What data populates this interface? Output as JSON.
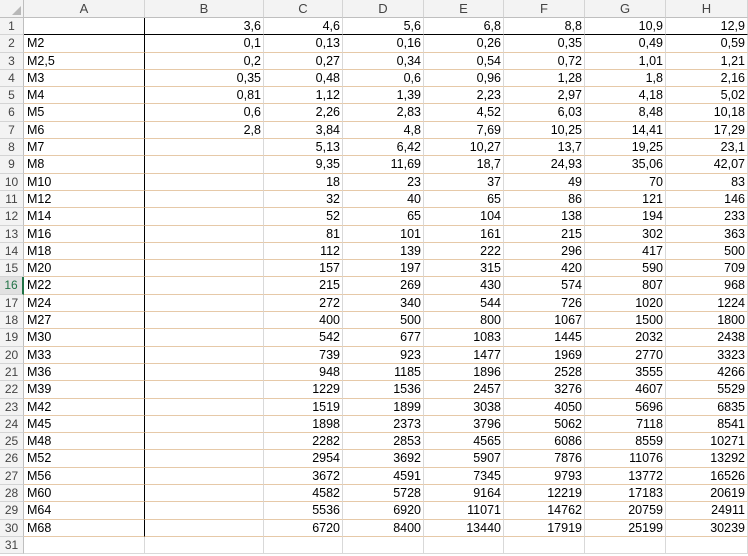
{
  "columns": [
    "A",
    "B",
    "C",
    "D",
    "E",
    "F",
    "G",
    "H"
  ],
  "rows": [
    [
      "",
      "3,6",
      "4,6",
      "5,6",
      "6,8",
      "8,8",
      "10,9",
      "12,9"
    ],
    [
      "M2",
      "0,1",
      "0,13",
      "0,16",
      "0,26",
      "0,35",
      "0,49",
      "0,59"
    ],
    [
      "M2,5",
      "0,2",
      "0,27",
      "0,34",
      "0,54",
      "0,72",
      "1,01",
      "1,21"
    ],
    [
      "M3",
      "0,35",
      "0,48",
      "0,6",
      "0,96",
      "1,28",
      "1,8",
      "2,16"
    ],
    [
      "M4",
      "0,81",
      "1,12",
      "1,39",
      "2,23",
      "2,97",
      "4,18",
      "5,02"
    ],
    [
      "M5",
      "0,6",
      "2,26",
      "2,83",
      "4,52",
      "6,03",
      "8,48",
      "10,18"
    ],
    [
      "M6",
      "2,8",
      "3,84",
      "4,8",
      "7,69",
      "10,25",
      "14,41",
      "17,29"
    ],
    [
      "M7",
      "",
      "5,13",
      "6,42",
      "10,27",
      "13,7",
      "19,25",
      "23,1"
    ],
    [
      "M8",
      "",
      "9,35",
      "11,69",
      "18,7",
      "24,93",
      "35,06",
      "42,07"
    ],
    [
      "M10",
      "",
      "18",
      "23",
      "37",
      "49",
      "70",
      "83"
    ],
    [
      "M12",
      "",
      "32",
      "40",
      "65",
      "86",
      "121",
      "146"
    ],
    [
      "M14",
      "",
      "52",
      "65",
      "104",
      "138",
      "194",
      "233"
    ],
    [
      "M16",
      "",
      "81",
      "101",
      "161",
      "215",
      "302",
      "363"
    ],
    [
      "M18",
      "",
      "112",
      "139",
      "222",
      "296",
      "417",
      "500"
    ],
    [
      "M20",
      "",
      "157",
      "197",
      "315",
      "420",
      "590",
      "709"
    ],
    [
      "M22",
      "",
      "215",
      "269",
      "430",
      "574",
      "807",
      "968"
    ],
    [
      "M24",
      "",
      "272",
      "340",
      "544",
      "726",
      "1020",
      "1224"
    ],
    [
      "M27",
      "",
      "400",
      "500",
      "800",
      "1067",
      "1500",
      "1800"
    ],
    [
      "M30",
      "",
      "542",
      "677",
      "1083",
      "1445",
      "2032",
      "2438"
    ],
    [
      "M33",
      "",
      "739",
      "923",
      "1477",
      "1969",
      "2770",
      "3323"
    ],
    [
      "M36",
      "",
      "948",
      "1185",
      "1896",
      "2528",
      "3555",
      "4266"
    ],
    [
      "M39",
      "",
      "1229",
      "1536",
      "2457",
      "3276",
      "4607",
      "5529"
    ],
    [
      "M42",
      "",
      "1519",
      "1899",
      "3038",
      "4050",
      "5696",
      "6835"
    ],
    [
      "M45",
      "",
      "1898",
      "2373",
      "3796",
      "5062",
      "7118",
      "8541"
    ],
    [
      "M48",
      "",
      "2282",
      "2853",
      "4565",
      "6086",
      "8559",
      "10271"
    ],
    [
      "M52",
      "",
      "2954",
      "3692",
      "5907",
      "7876",
      "11076",
      "13292"
    ],
    [
      "M56",
      "",
      "3672",
      "4591",
      "7345",
      "9793",
      "13772",
      "16526"
    ],
    [
      "M60",
      "",
      "4582",
      "5728",
      "9164",
      "12219",
      "17183",
      "20619"
    ],
    [
      "M64",
      "",
      "5536",
      "6920",
      "11071",
      "14762",
      "20759",
      "24911"
    ],
    [
      "M68",
      "",
      "6720",
      "8400",
      "13440",
      "17919",
      "25199",
      "30239"
    ],
    [
      "",
      "",
      "",
      "",
      "",
      "",
      "",
      ""
    ]
  ],
  "row_numbers": [
    "1",
    "2",
    "3",
    "4",
    "5",
    "6",
    "7",
    "8",
    "9",
    "10",
    "11",
    "12",
    "13",
    "14",
    "15",
    "16",
    "17",
    "18",
    "19",
    "20",
    "21",
    "22",
    "23",
    "24",
    "25",
    "26",
    "27",
    "28",
    "29",
    "30",
    "31"
  ],
  "active_row": "16",
  "accent_color": "#217346"
}
